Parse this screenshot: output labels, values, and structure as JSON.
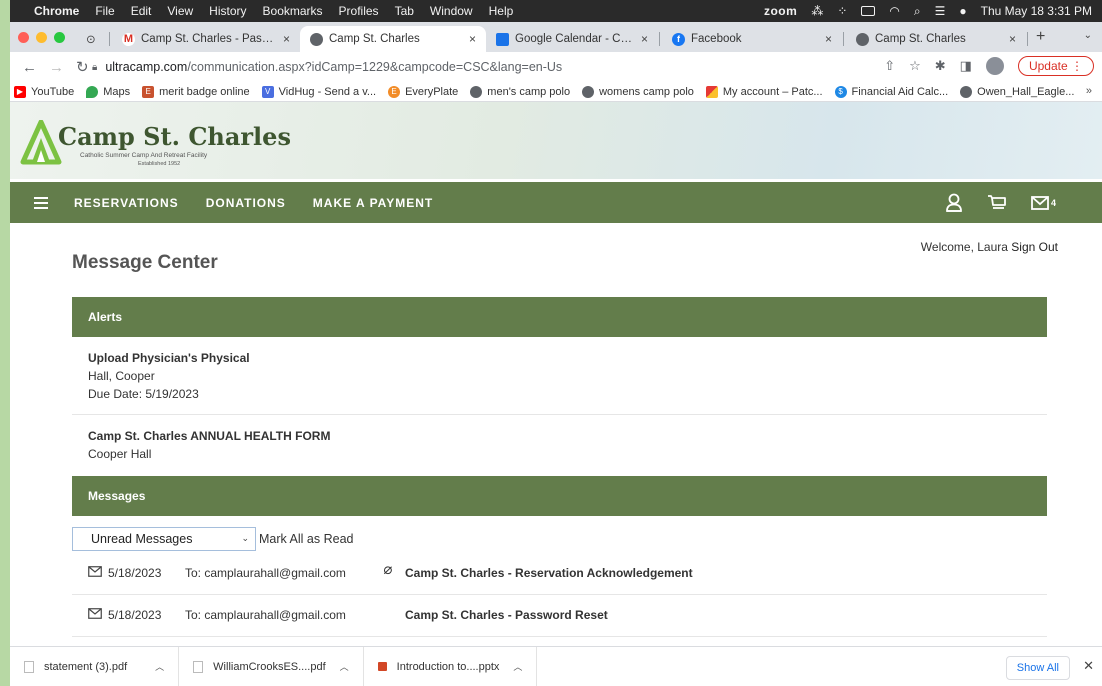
{
  "menubar": {
    "app": "Chrome",
    "items": [
      "File",
      "Edit",
      "View",
      "History",
      "Bookmarks",
      "Profiles",
      "Tab",
      "Window",
      "Help"
    ],
    "zoom": "zoom",
    "datetime": "Thu May 18  3:31 PM"
  },
  "tabs": [
    {
      "label": "Camp St. Charles - Password R",
      "icon": "gmail-icon"
    },
    {
      "label": "Camp St. Charles",
      "icon": "globe-icon"
    },
    {
      "label": "Google Calendar - Calendar se",
      "icon": "calendar-icon"
    },
    {
      "label": "Facebook",
      "icon": "facebook-icon"
    },
    {
      "label": "Camp St. Charles",
      "icon": "globe-icon"
    }
  ],
  "address": {
    "host": "ultracamp.com",
    "path": "/communication.aspx?idCamp=1229&campcode=CSC&lang=en-Us",
    "update_label": "Update"
  },
  "bookmarks": [
    "YouTube",
    "Maps",
    "merit badge online",
    "VidHug - Send a v...",
    "EveryPlate",
    "men's camp polo",
    "womens camp polo",
    "My account – Patc...",
    "Financial Aid Calc...",
    "Owen_Hall_Eagle..."
  ],
  "site": {
    "logo_title": "Camp St. Charles",
    "logo_subtitle": "Catholic Summer Camp And Retreat Facility",
    "logo_established": "Established 1952"
  },
  "nav": {
    "links": [
      "RESERVATIONS",
      "DONATIONS",
      "MAKE A PAYMENT"
    ],
    "mail_count": "4"
  },
  "welcome": {
    "greeting": "Welcome, Laura",
    "signout": "Sign Out"
  },
  "page_title": "Message Center",
  "alerts": {
    "heading": "Alerts",
    "items": [
      {
        "title": "Upload Physician's Physical",
        "name": "Hall, Cooper",
        "due": "Due Date: 5/19/2023"
      },
      {
        "title": "Camp St. Charles ANNUAL HEALTH FORM",
        "name": "Cooper Hall"
      }
    ]
  },
  "messages": {
    "heading": "Messages",
    "filter_value": "Unread Messages",
    "mark_all": "Mark All as Read",
    "items": [
      {
        "date": "5/18/2023",
        "to": "To: camplaurahall@gmail.com",
        "subject": "Camp St. Charles - Reservation Acknowledgement",
        "attachment": true
      },
      {
        "date": "5/18/2023",
        "to": "To: camplaurahall@gmail.com",
        "subject": "Camp St. Charles - Password Reset",
        "attachment": false
      }
    ]
  },
  "downloads": {
    "files": [
      "statement (3).pdf",
      "WilliamCrooksES....pdf",
      "Introduction to....pptx"
    ],
    "show_all": "Show All"
  },
  "colors": {
    "nav_green": "#637d4b",
    "logo_green": "#3e5630",
    "select_border": "#a5bedc"
  }
}
